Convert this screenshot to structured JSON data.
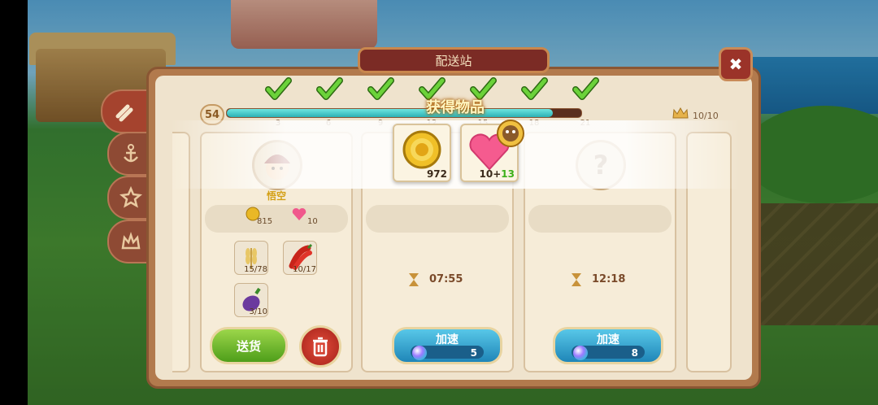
{
  "window": {
    "title": "配送站",
    "close_symbol": "✖"
  },
  "progress": {
    "level": "54",
    "ticks": [
      "3",
      "6",
      "9",
      "12",
      "15",
      "18",
      "21"
    ],
    "checks_completed": 7,
    "fill_fraction": 0.92,
    "crown_count": "10/10"
  },
  "popup": {
    "title": "获得物品",
    "items": [
      {
        "icon": "coin-icon",
        "count": "972"
      },
      {
        "icon": "heart-icon",
        "count_base": "10+",
        "count_bonus": "13"
      }
    ]
  },
  "orders": [
    {
      "customer_name": "悟空",
      "reward_coins": "815",
      "reward_hearts": "10",
      "items": [
        {
          "icon": "wheat-icon",
          "count": "15/78"
        },
        {
          "icon": "chili-icon",
          "count": "10/17"
        },
        {
          "icon": "eggplant-icon",
          "count": "3/10"
        }
      ],
      "deliver_label": "送货"
    },
    {
      "timer": "07:55",
      "speed_label": "加速",
      "speed_cost": "5"
    },
    {
      "timer": "12:18",
      "speed_label": "加速",
      "speed_cost": "8"
    }
  ],
  "colors": {
    "accent": "#7b2b25",
    "progress": "#2cb0b4",
    "deliver": "#4e9e1a",
    "speed": "#1f86b8"
  }
}
